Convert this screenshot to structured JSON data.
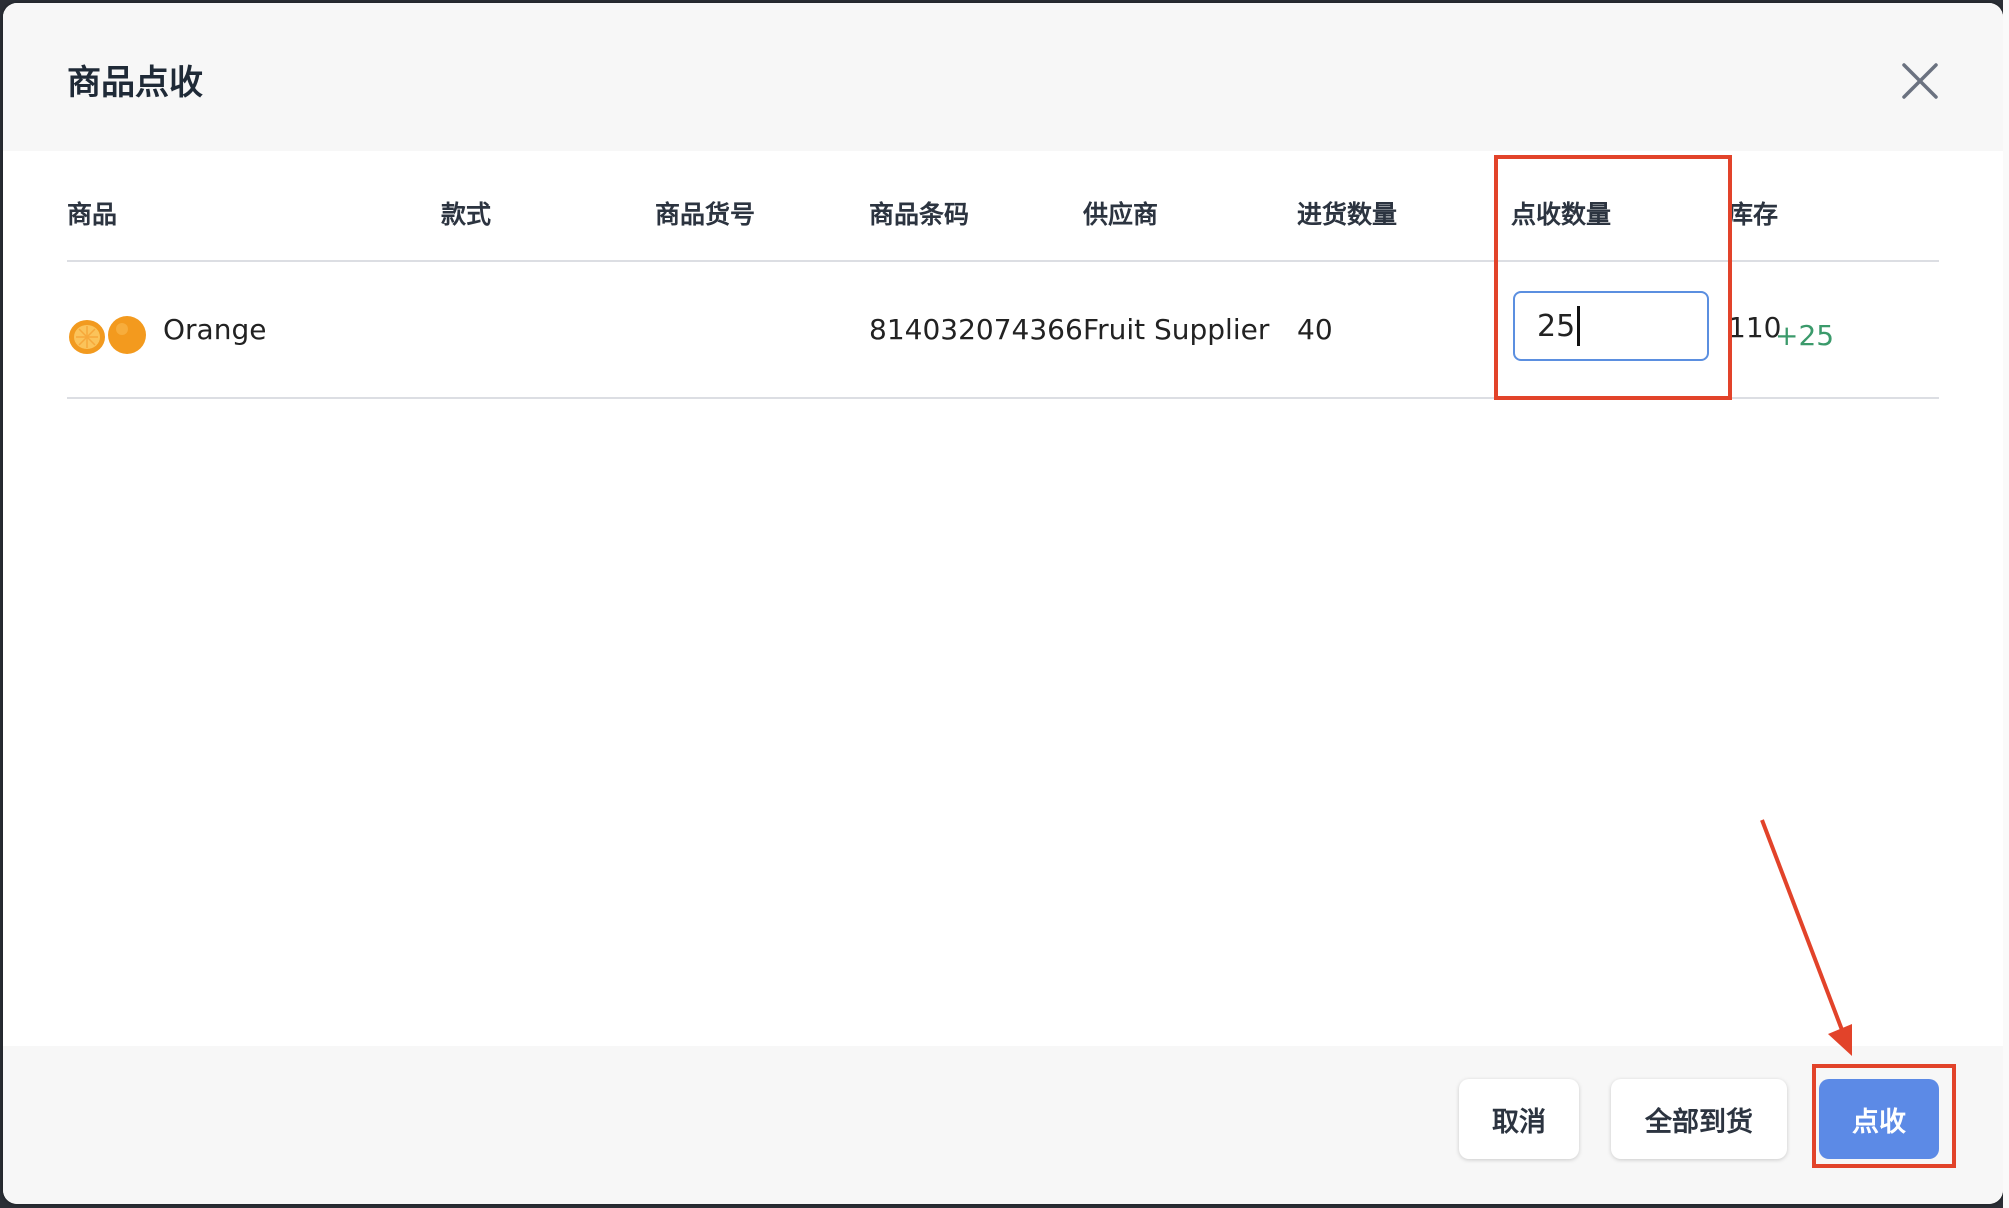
{
  "dialog": {
    "title": "商品点收",
    "close_icon": "close-icon"
  },
  "table": {
    "headers": [
      "商品",
      "款式",
      "商品货号",
      "商品条码",
      "供应商",
      "进货数量",
      "点收数量",
      "库存"
    ],
    "rows": [
      {
        "product_name": "Orange",
        "product_icon": "orange-thumbnail-icon",
        "style": "",
        "item_number": "",
        "barcode": "814032074366",
        "supplier": "Fruit Supplier",
        "purchase_qty": "40",
        "receive_qty": "25",
        "stock": "110",
        "stock_delta": "+25"
      }
    ]
  },
  "footer": {
    "cancel_label": "取消",
    "all_arrived_label": "全部到货",
    "receive_label": "点收"
  },
  "colors": {
    "primary_button": "#5c8ae6",
    "stock_delta": "#3b9a6b",
    "annotation": "#e2432a",
    "input_border": "#5b8fe0"
  }
}
